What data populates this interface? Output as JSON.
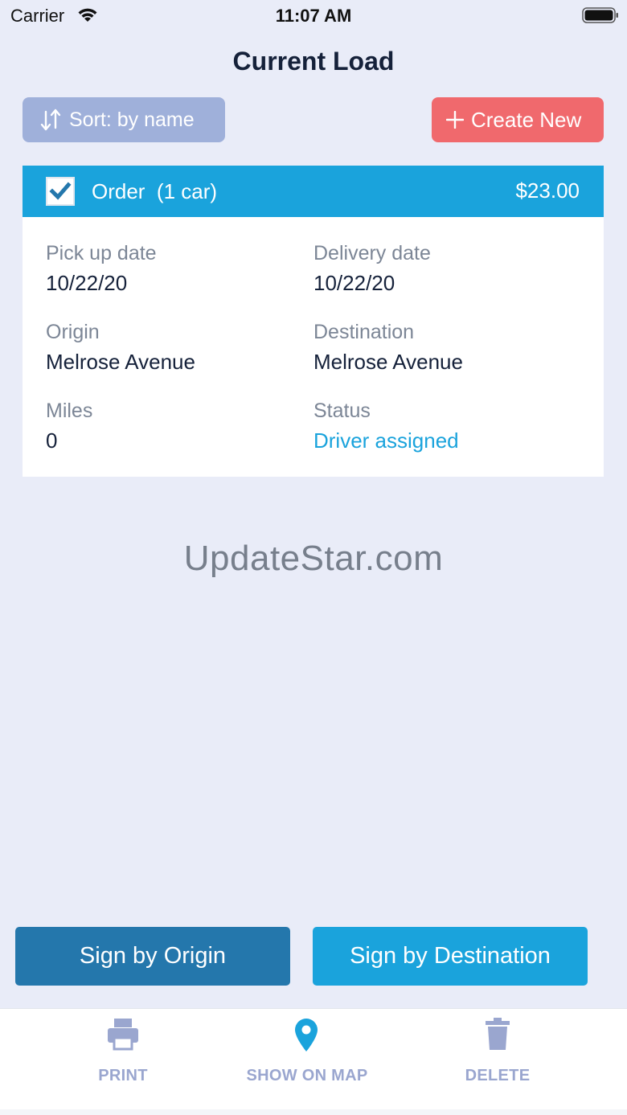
{
  "status_bar": {
    "carrier": "Carrier",
    "time": "11:07 AM"
  },
  "header": {
    "title": "Current Load"
  },
  "toolbar": {
    "sort_label": "Sort: by name",
    "create_label": "Create New"
  },
  "order": {
    "title": "Order  (1 car)",
    "price": "$23.00",
    "checked": true,
    "fields": {
      "pickup_label": "Pick up date",
      "pickup_value": "10/22/20",
      "delivery_label": "Delivery date",
      "delivery_value": "10/22/20",
      "origin_label": "Origin",
      "origin_value": "Melrose Avenue",
      "destination_label": "Destination",
      "destination_value": "Melrose Avenue",
      "miles_label": "Miles",
      "miles_value": "0",
      "status_label": "Status",
      "status_value": "Driver assigned"
    }
  },
  "watermark": "UpdateStar.com",
  "actions": {
    "sign_origin": "Sign by Origin",
    "sign_destination": "Sign by Destination"
  },
  "tab_bar": {
    "print": "PRINT",
    "show_on_map": "SHOW ON MAP",
    "delete": "DELETE"
  },
  "colors": {
    "background": "#e9ecf8",
    "accent_blue": "#1aa3dc",
    "dark_blue": "#2477ac",
    "create_red": "#f0696d",
    "sort_button": "#9fb0da",
    "tab_icon": "#9aa6cf"
  },
  "icons": {
    "wifi": "wifi-icon",
    "battery": "battery-icon",
    "sort": "sort-arrows-icon",
    "create": "plus-icon",
    "checkbox": "checkmark-icon",
    "print": "printer-icon",
    "map": "map-pin-icon",
    "delete": "trash-icon"
  }
}
